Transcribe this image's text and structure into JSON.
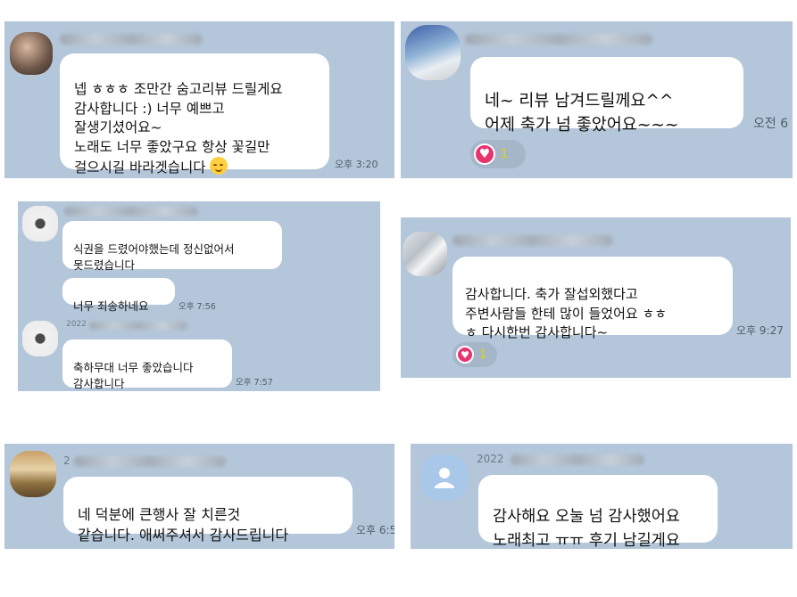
{
  "panels": [
    {
      "messages": [
        {
          "text": "넵 ㅎㅎㅎ 조만간 숨고리뷰 드릴게요\n감사합니다 :) 너무 예쁘고\n잘생기셨어요~\n노래도 너무 좋았구요 항상 꽃길만\n걸으시길 바라겟습니다",
          "emoji": "smiling-face-icon",
          "time": "오후 3:20"
        }
      ]
    },
    {
      "messages": [
        {
          "text": "네~ 리뷰 남겨드릴께요^^\n어제 축가 넘 좋았어요~~~",
          "time": "오전 6"
        }
      ],
      "reaction": {
        "icon": "heart-icon",
        "count": "1",
        "color": "#e8336f"
      }
    },
    {
      "messages": [
        {
          "text": "식권을 드렸어야했는데 정신없어서\n못드렸습니다"
        },
        {
          "text": "너무 죄송하네요",
          "time": "오후 7:56"
        },
        {
          "text": "축하무대 너무 좋았습니다\n감사합니다",
          "time": "오후 7:57"
        }
      ],
      "name_fragment": "2022"
    },
    {
      "messages": [
        {
          "text": "감사합니다. 축가 잘섭외했다고\n주변사람들 한테 많이 들었어요 ㅎㅎ\nㅎ 다시한번 감사합니다~",
          "time": "오후 9:27"
        }
      ],
      "reaction": {
        "icon": "heart-icon",
        "count": "1",
        "color": "#e8336f"
      }
    },
    {
      "messages": [
        {
          "text": "네 덕분에 큰행사 잘 치른것\n같습니다. 애써주셔서 감사드립니다",
          "time": "오후 6:5"
        }
      ],
      "name_fragment": "2"
    },
    {
      "messages": [
        {
          "text": "감사해요 오눌 넘 감사했어요\n노래최고 ㅠㅠ 후기 남길게요"
        }
      ],
      "name_fragment": "2022"
    }
  ],
  "colors": {
    "chat_background": "#b4c6d9",
    "bubble": "#ffffff",
    "heart": "#e8336f"
  }
}
